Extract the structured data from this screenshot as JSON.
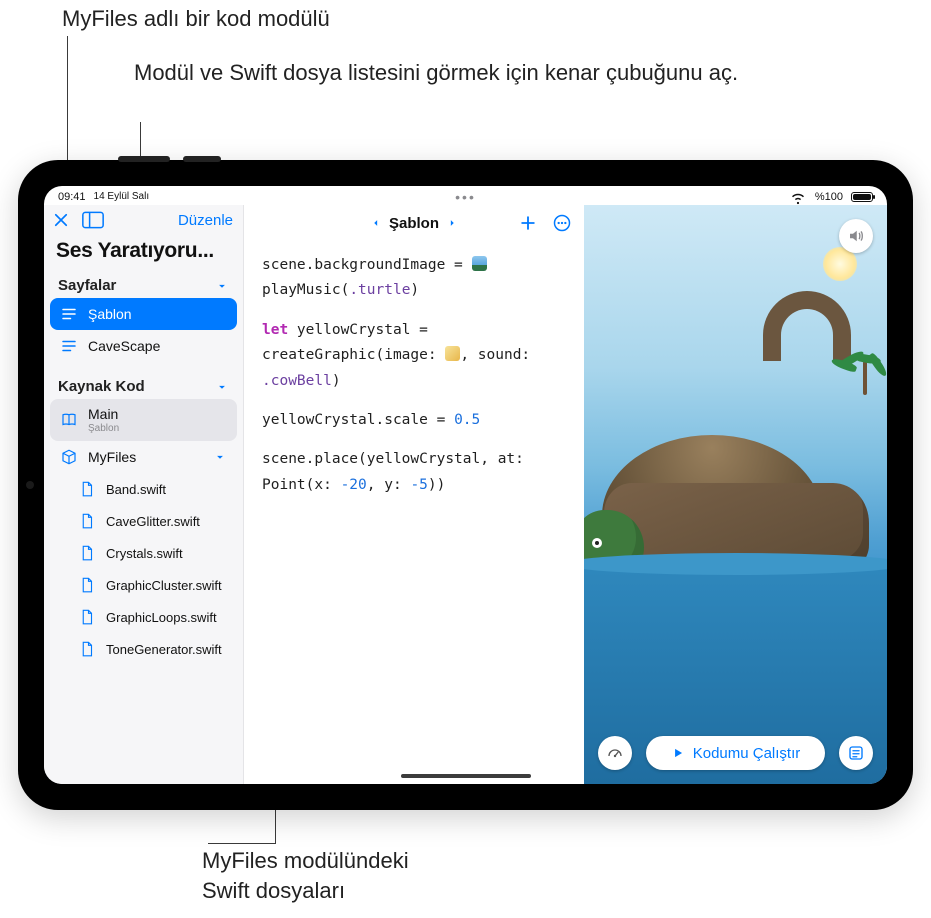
{
  "callouts": {
    "c1": "MyFiles adlı bir kod modülü",
    "c2": "Modül ve Swift dosya listesini görmek için kenar çubuğunu aç.",
    "c3a": "MyFiles modülündeki",
    "c3b": "Swift dosyaları"
  },
  "statusbar": {
    "time": "09:41",
    "date": "14 Eylül Salı",
    "battery_pct": "%100"
  },
  "sidebar": {
    "edit": "Düzenle",
    "title": "Ses Yaratıyoru...",
    "pages_header": "Sayfalar",
    "pages": [
      {
        "label": "Şablon"
      },
      {
        "label": "CaveScape"
      }
    ],
    "source_header": "Kaynak Kod",
    "main": {
      "label": "Main",
      "sub": "Şablon"
    },
    "module": {
      "label": "MyFiles"
    },
    "files": [
      {
        "label": "Band.swift"
      },
      {
        "label": "CaveGlitter.swift"
      },
      {
        "label": "Crystals.swift"
      },
      {
        "label": "GraphicCluster.swift"
      },
      {
        "label": "GraphicLoops.swift"
      },
      {
        "label": "ToneGenerator.swift"
      }
    ]
  },
  "editor": {
    "nav_title": "Şablon",
    "code": {
      "l1a": "scene.backgroundImage = ",
      "l2a": "playMusic(",
      "l2b": ".turtle",
      "l2c": ")",
      "l3a": "let",
      "l3b": " yellowCrystal =",
      "l4a": " createGraphic(image: ",
      "l4b": ", sound:",
      "l5a": " ",
      "l5b": ".cowBell",
      "l5c": ")",
      "l6a": "yellowCrystal.scale = ",
      "l6b": "0.5",
      "l7a": "scene.place(yellowCrystal, at:",
      "l8a": " Point(x: ",
      "l8b": "-20",
      "l8c": ", y: ",
      "l8d": "-5",
      "l8e": "))"
    }
  },
  "preview": {
    "run_label": "Kodumu Çalıştır"
  }
}
